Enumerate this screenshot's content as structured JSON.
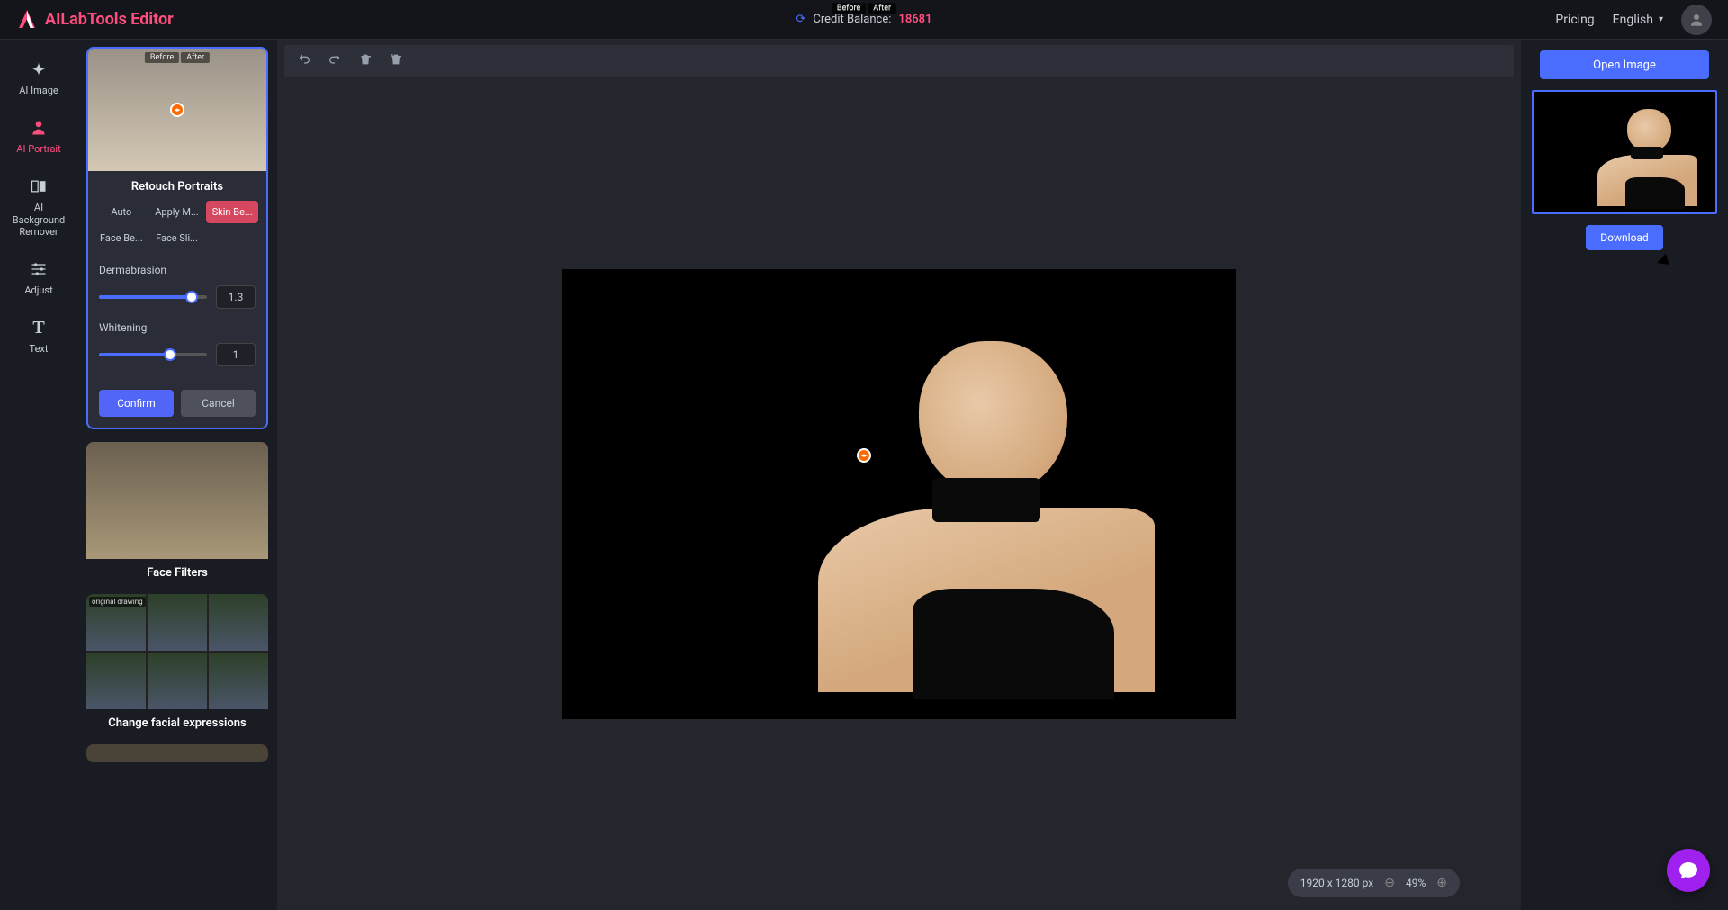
{
  "header": {
    "app_name": "AILabTools Editor",
    "credit_label": "Credit Balance:",
    "credit_value": "18681",
    "pricing": "Pricing",
    "language": "English"
  },
  "rail": {
    "ai_image": "AI Image",
    "ai_portrait": "AI Portrait",
    "bg_remover": "AI Background Remover",
    "adjust": "Adjust",
    "text": "Text"
  },
  "retouch": {
    "before": "Before",
    "after": "After",
    "title": "Retouch Portraits",
    "tabs": {
      "auto": "Auto",
      "apply_m": "Apply M...",
      "skin_be": "Skin Be...",
      "face_be": "Face Be...",
      "face_sli": "Face Sli..."
    },
    "dermabrasion_label": "Dermabrasion",
    "dermabrasion_value": "1.3",
    "whitening_label": "Whitening",
    "whitening_value": "1",
    "confirm": "Confirm",
    "cancel": "Cancel"
  },
  "face_filters": {
    "title": "Face Filters"
  },
  "expressions": {
    "title": "Change facial expressions",
    "original_tag": "original drawing"
  },
  "canvas": {
    "dimensions": "1920 x 1280 px",
    "zoom": "49%"
  },
  "right": {
    "open_image": "Open Image",
    "download": "Download"
  }
}
